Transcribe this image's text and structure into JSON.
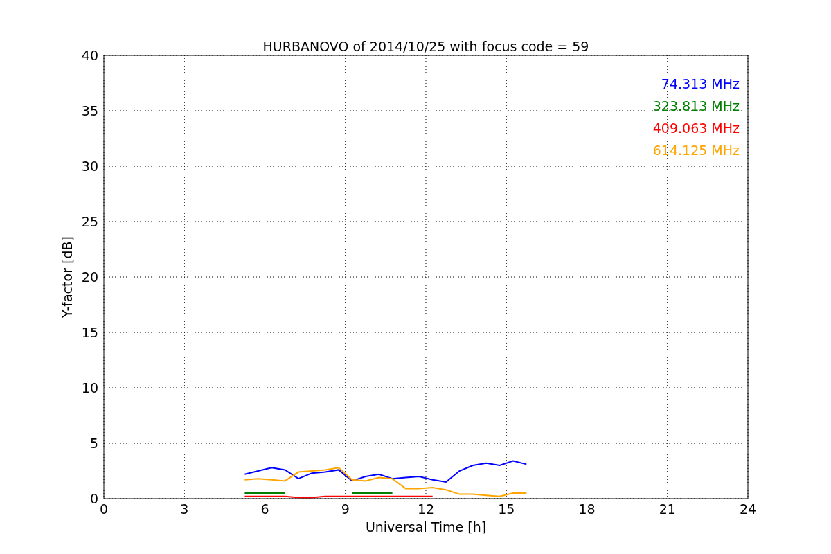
{
  "chart_data": {
    "type": "line",
    "title": "HURBANOVO of 2014/10/25 with focus code = 59",
    "xlabel": "Universal Time [h]",
    "ylabel": "Y-factor [dB]",
    "xlim": [
      0,
      24
    ],
    "ylim": [
      0,
      40
    ],
    "xticks": [
      0,
      3,
      6,
      9,
      12,
      15,
      18,
      21,
      24
    ],
    "yticks": [
      0,
      5,
      10,
      15,
      20,
      25,
      30,
      35,
      40
    ],
    "grid": true,
    "x": [
      5.25,
      5.75,
      6.25,
      6.75,
      7.25,
      7.75,
      8.25,
      8.75,
      9.25,
      9.75,
      10.25,
      10.75,
      11.25,
      11.75,
      12.25,
      12.75,
      13.25,
      13.75,
      14.25,
      14.75,
      15.25,
      15.75
    ],
    "series": [
      {
        "name": "74.313 MHz",
        "color": "#0000ff",
        "values": [
          2.2,
          2.5,
          2.8,
          2.6,
          1.8,
          2.3,
          2.4,
          2.6,
          1.6,
          2.0,
          2.2,
          1.8,
          1.9,
          2.0,
          1.7,
          1.5,
          2.5,
          3.0,
          3.2,
          3.0,
          3.4,
          3.1
        ]
      },
      {
        "name": "323.813 MHz",
        "color": "#008000",
        "values": [
          0.5,
          0.5,
          0.5,
          0.5,
          null,
          null,
          null,
          null,
          0.5,
          0.5,
          0.5,
          0.5,
          null,
          null,
          null,
          null,
          null,
          null,
          null,
          null,
          null,
          null
        ]
      },
      {
        "name": "409.063 MHz",
        "color": "#ff0000",
        "values": [
          0.2,
          0.2,
          0.2,
          0.2,
          0.1,
          0.1,
          0.2,
          0.2,
          0.2,
          0.2,
          0.2,
          0.2,
          0.2,
          0.2,
          0.2,
          null,
          null,
          null,
          null,
          null,
          null,
          null
        ]
      },
      {
        "name": "614.125 MHz",
        "color": "#ffa500",
        "values": [
          1.7,
          1.8,
          1.7,
          1.6,
          2.4,
          2.5,
          2.6,
          2.8,
          1.7,
          1.6,
          1.9,
          1.8,
          0.9,
          0.9,
          1.0,
          0.8,
          0.4,
          0.4,
          0.3,
          0.2,
          0.5,
          0.5
        ]
      }
    ]
  }
}
